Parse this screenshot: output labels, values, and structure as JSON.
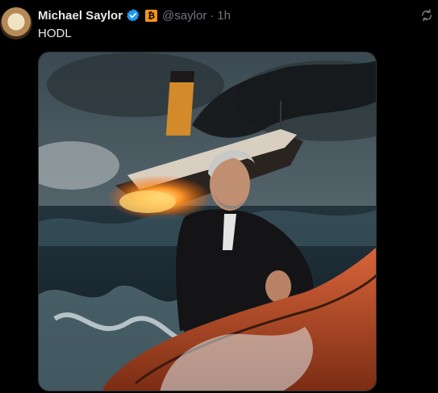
{
  "tweet": {
    "author_name": "Michael Saylor",
    "handle": "@saylor",
    "separator": "·",
    "time": "1h",
    "badge_glyph": "₿",
    "text": "HODL"
  },
  "icons": {
    "avatar": "avatar",
    "verified": "verified-check-icon",
    "badge": "bitcoin-badge-icon",
    "refresh": "refresh-icon"
  },
  "colors": {
    "background": "#000000",
    "verified_blue": "#1d9bf0",
    "bitcoin_orange": "#f7931a",
    "secondary_text": "#71767b"
  }
}
